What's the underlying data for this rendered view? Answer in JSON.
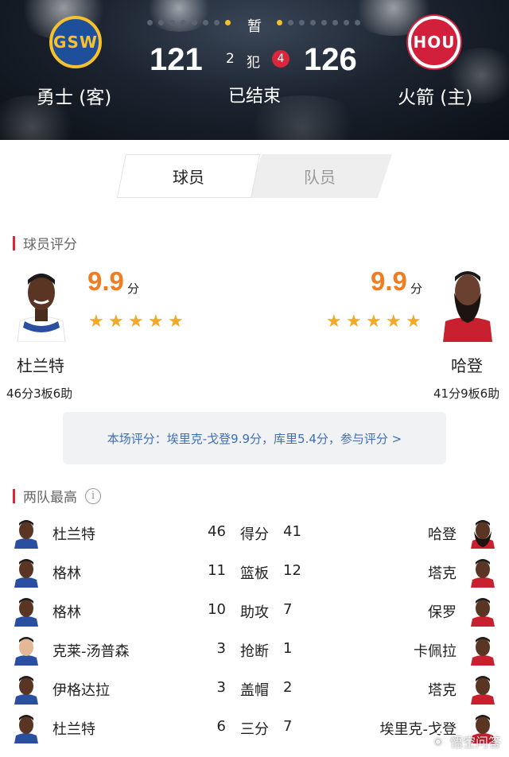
{
  "header": {
    "pause_text": "暂",
    "away": {
      "abbr": "GSW",
      "name": "勇士 (客)",
      "score": "121",
      "fouls": "2"
    },
    "home": {
      "abbr": "HOU",
      "name": "火箭 (主)",
      "score": "126",
      "fouls": "4"
    },
    "fouls_label": "犯",
    "status": "已结束",
    "colors": {
      "gsw_blue": "#1d4f9a",
      "gsw_gold": "#f6c12c",
      "hou_red": "#d21f3b"
    }
  },
  "tabs": [
    {
      "label": "球员",
      "active": true
    },
    {
      "label": "队员",
      "active": false
    }
  ],
  "ratings_section": {
    "title": "球员评分",
    "left": {
      "name": "杜兰特",
      "rating": "9.9",
      "unit": "分",
      "stars": 5,
      "stats": "46分3板6助"
    },
    "right": {
      "name": "哈登",
      "rating": "9.9",
      "unit": "分",
      "stars": 5,
      "stats": "41分9板6助"
    },
    "banner": "本场评分：埃里克-戈登9.9分，库里5.4分，参与评分 >"
  },
  "leaders_section": {
    "title": "两队最高",
    "info_icon": "i",
    "rows": [
      {
        "left_name": "杜兰特",
        "left_val": "46",
        "category": "得分",
        "right_val": "41",
        "right_name": "哈登",
        "left_face": "dark",
        "right_face": "beard"
      },
      {
        "left_name": "格林",
        "left_val": "11",
        "category": "篮板",
        "right_val": "12",
        "right_name": "塔克",
        "left_face": "dark",
        "right_face": "dark"
      },
      {
        "left_name": "格林",
        "left_val": "10",
        "category": "助攻",
        "right_val": "7",
        "right_name": "保罗",
        "left_face": "dark",
        "right_face": "dark"
      },
      {
        "left_name": "克莱-汤普森",
        "left_val": "3",
        "category": "抢断",
        "right_val": "1",
        "right_name": "卡佩拉",
        "left_face": "light",
        "right_face": "dark"
      },
      {
        "left_name": "伊格达拉",
        "left_val": "3",
        "category": "盖帽",
        "right_val": "2",
        "right_name": "塔克",
        "left_face": "dark",
        "right_face": "dark"
      },
      {
        "left_name": "杜兰特",
        "left_val": "6",
        "category": "三分",
        "right_val": "7",
        "right_name": "埃里克-戈登",
        "left_face": "dark",
        "right_face": "dark"
      }
    ]
  },
  "watermark": {
    "text": "悟空问答",
    "icon": "wukong-icon"
  }
}
